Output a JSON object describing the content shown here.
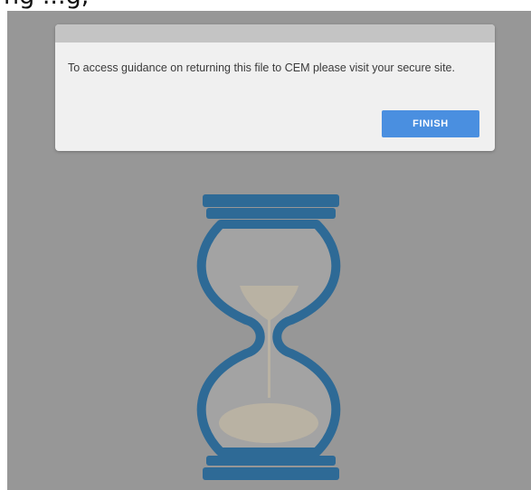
{
  "background_text": "ng ...g,",
  "dialog": {
    "message": "To access guidance on returning this file to CEM please visit your secure site.",
    "finish_label": "FINISH"
  },
  "icons": {
    "loader": "hourglass-icon"
  },
  "colors": {
    "overlay": "#979797",
    "dialog_background": "#f0f0f0",
    "dialog_titlebar": "#c4c4c4",
    "button": "#4a8fe0",
    "hourglass_frame": "#2e6a96",
    "hourglass_glass": "#a3a3a3",
    "hourglass_sand": "#b9b2a3"
  }
}
